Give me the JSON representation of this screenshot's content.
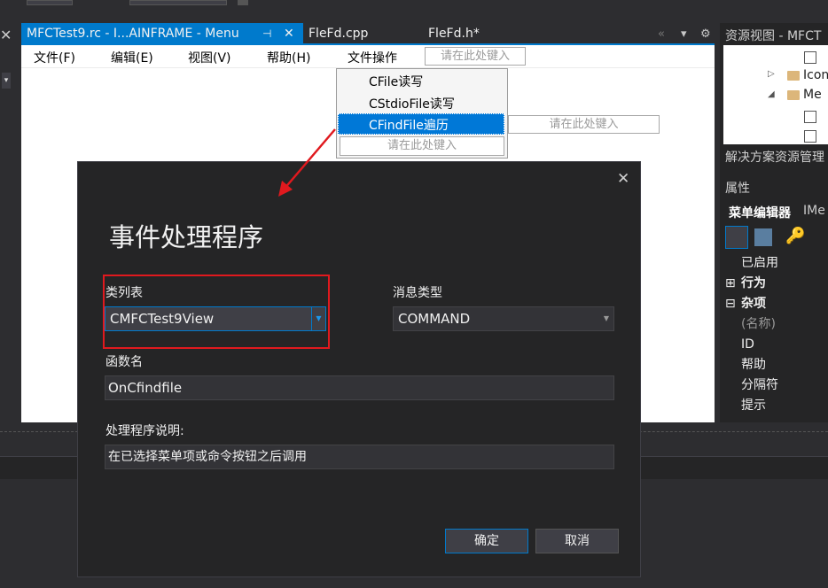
{
  "tabs": [
    {
      "label": "MFCTest9.rc - I...AINFRAME - Menu",
      "active": true
    },
    {
      "label": "FleFd.cpp",
      "active": false
    },
    {
      "label": "FleFd.h*",
      "active": false
    }
  ],
  "tab_icons": {
    "pin": "⊣",
    "close": "✕",
    "scroll_left": "«",
    "overflow": "▾",
    "settings": "⚙"
  },
  "menubar": {
    "items": [
      "文件(F)",
      "编辑(E)",
      "视图(V)",
      "帮助(H)",
      "文件操作"
    ],
    "type_here": "请在此处键入"
  },
  "dropdown": {
    "items": [
      "CFile读写",
      "CStdioFile读写",
      "CFindFile遍历"
    ],
    "selected": "CFindFile遍历",
    "type_here": "请在此处键入",
    "submenu_type_here": "请在此处键入"
  },
  "right_panel": {
    "resource_view_title": "资源视图 - MFCT",
    "tree": [
      "Icon",
      "Me"
    ],
    "solution_explorer": "解决方案资源管理",
    "properties_title": "属性",
    "properties_object": "菜单编辑器",
    "properties_object_type": "IMe",
    "properties": [
      {
        "label": "已启用",
        "kind": "item"
      },
      {
        "label": "行为",
        "kind": "category",
        "collapsed": true
      },
      {
        "label": "杂项",
        "kind": "category",
        "collapsed": false
      },
      {
        "label": "(名称)",
        "kind": "item"
      },
      {
        "label": "ID",
        "kind": "item"
      },
      {
        "label": "帮助",
        "kind": "item"
      },
      {
        "label": "分隔符",
        "kind": "item"
      },
      {
        "label": "提示",
        "kind": "item"
      }
    ]
  },
  "dialog": {
    "title": "事件处理程序",
    "close_icon": "✕",
    "class_list_label": "类列表",
    "class_list_value": "CMFCTest9View",
    "message_type_label": "消息类型",
    "message_type_value": "COMMAND",
    "function_name_label": "函数名",
    "function_name_value": "OnCfindfile",
    "description_label": "处理程序说明:",
    "description_value": "在已选择菜单项或命令按钮之后调用",
    "ok_label": "确定",
    "cancel_label": "取消"
  },
  "colors": {
    "accent": "#007acc",
    "annotation": "#e0191e",
    "dialog_bg": "#252526"
  }
}
